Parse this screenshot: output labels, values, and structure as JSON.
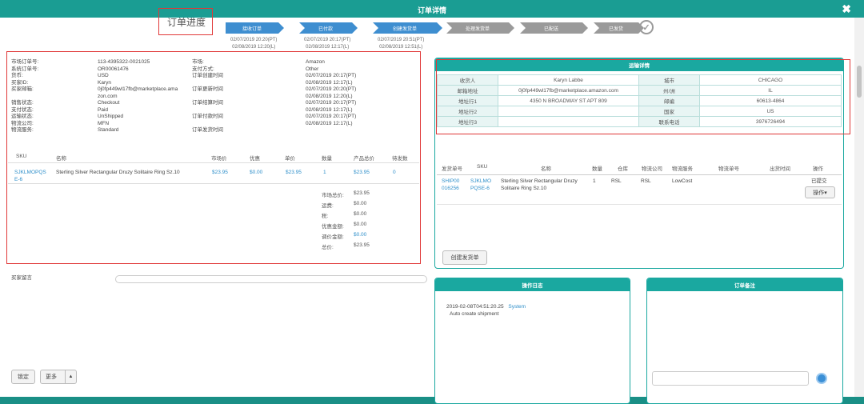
{
  "window": {
    "title": "订单详情",
    "close": "✖"
  },
  "progress": {
    "label": "订单进度",
    "steps": [
      {
        "label": "接收订单"
      },
      {
        "label": "已付款"
      },
      {
        "label": "创建发货单"
      },
      {
        "label": "处理发货单"
      },
      {
        "label": "已配送"
      },
      {
        "label": "已发货"
      }
    ],
    "check_icon": "check-circle-icon",
    "dates": [
      {
        "l1": "02/07/2019 20:20(PT)",
        "l2": "02/08/2019 12:20(L)"
      },
      {
        "l1": "02/07/2019 20:17(PT)",
        "l2": "02/08/2019 12:17(L)"
      },
      {
        "l1": "02/07/2019 20:51(PT)",
        "l2": "02/08/2019 12:51(L)"
      }
    ]
  },
  "order_info": {
    "labels": [
      "市场订单号:",
      "系统订单号:",
      "货币:",
      "买家ID:",
      "买家邮箱:",
      "",
      "销售状态:",
      "支付状态:",
      "运输状态:",
      "物流公司:",
      "物流服务:"
    ],
    "values": [
      "113-4395322-0021025",
      "OR00061476",
      "USD",
      "Karyn",
      "0j0fp449wl17fb@marketplace.ama",
      "zon.com",
      "Checkout",
      "Paid",
      "UnShipped",
      "MFN",
      "Standard"
    ],
    "labels2": [
      "市场:",
      "支付方式:",
      "订单创建时间",
      "",
      "订单更新时间",
      "",
      "订单结算时间",
      "",
      "订单付款时间",
      "",
      "订单发货时间"
    ],
    "values2": [
      "Amazon",
      "Other",
      "02/07/2019 20:17(PT)",
      "02/08/2019 12:17(L)",
      "02/07/2019 20:20(PT)",
      "02/08/2019 12:20(L)",
      "02/07/2019 20:17(PT)",
      "02/08/2019 12:17(L)",
      "02/07/2019 20:17(PT)",
      "02/08/2019 12:17(L)",
      ""
    ]
  },
  "items_table": {
    "headers": [
      "SKU",
      "名称",
      "市场价",
      "优惠",
      "单价",
      "数量",
      "产品总价",
      "待发数"
    ],
    "row": {
      "sku": "SJKLMOPQS E-6",
      "name": "Sterling Silver Rectangular Druzy Solitaire Ring Sz.10",
      "market_price": "$23.95",
      "discount": "$0.00",
      "unit_price": "$23.95",
      "qty": "1",
      "total": "$23.95",
      "pending": "0"
    }
  },
  "summary": [
    {
      "label": "市场总价:",
      "value": "$23.95"
    },
    {
      "label": "运费:",
      "value": "$0.00"
    },
    {
      "label": "税:",
      "value": "$0.00"
    },
    {
      "label": "优惠金额:",
      "value": "$0.00"
    },
    {
      "label": "调价金额:",
      "value": "$0.00"
    },
    {
      "label": "总价:",
      "value": "$23.95"
    }
  ],
  "buyer_message_label": "买家留言",
  "shipping": {
    "title": "运输详情",
    "rows": [
      {
        "l1": "收货人",
        "v1": "Karyn Labbe",
        "l2": "城市",
        "v2": "CHICAGO"
      },
      {
        "l1": "邮箱地址",
        "v1": "0j0fp449wl17fb@marketplace.amazon.com",
        "l2": "州/洲",
        "v2": "IL"
      },
      {
        "l1": "地址行1",
        "v1": "4350 N BROADWAY ST APT 809",
        "l2": "邮编",
        "v2": "60613-4864"
      },
      {
        "l1": "地址行2",
        "v1": "",
        "l2": "国家",
        "v2": "US"
      },
      {
        "l1": "地址行3",
        "v1": "",
        "l2": "联系电话",
        "v2": "3976726494"
      }
    ]
  },
  "shipment_table": {
    "headers": [
      "发货单号",
      "SKU",
      "名称",
      "数量",
      "仓库",
      "物流公司",
      "物流服务",
      "物流单号",
      "出货时间",
      "操作"
    ],
    "row": {
      "no": "SHIP00 016256",
      "sku": "SJKLMO PQSE-6",
      "name": "Sterling Silver Rectangular Druzy Solitaire Ring Sz.10",
      "qty": "1",
      "warehouse": "RSL",
      "carrier": "RSL",
      "service": "LowCost",
      "tracking": "",
      "ship_time": "",
      "status": "已提交",
      "action": "操作▾"
    },
    "create_button": "创建发货单"
  },
  "log": {
    "title": "操作日志",
    "entries": [
      {
        "time": "2019-02-08T04:51:20.25",
        "user": "System",
        "text": "Auto create shipment"
      }
    ]
  },
  "note": {
    "title": "订单备注"
  },
  "footer": {
    "lock_button": "锁定",
    "more_button": "更多",
    "more_caret": "▲"
  }
}
